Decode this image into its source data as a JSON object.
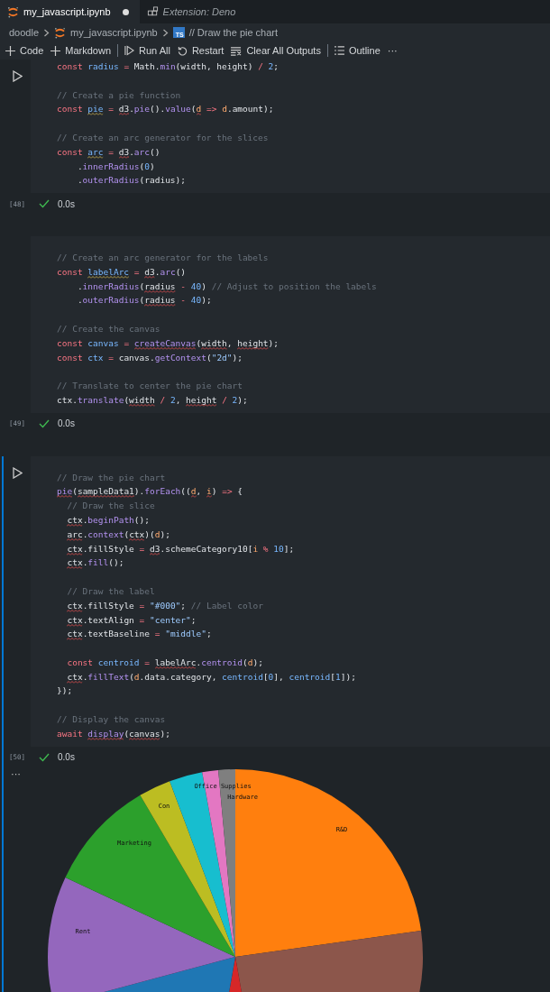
{
  "tabs": [
    {
      "label": "my_javascript.ipynb",
      "selected": true,
      "modified": true,
      "preview": false
    },
    {
      "label": "Extension: Deno",
      "selected": false,
      "modified": false,
      "preview": true
    }
  ],
  "breadcrumbs": [
    {
      "label": "doodle"
    },
    {
      "label": "my_javascript.ipynb"
    },
    {
      "label": "// Draw the pie chart",
      "badge": "TS"
    }
  ],
  "toolbar": [
    {
      "label": "Code",
      "divider_after": false
    },
    {
      "label": "Markdown",
      "divider_after": true
    },
    {
      "label": "Run All",
      "divider_after": false
    },
    {
      "label": "Restart",
      "divider_after": false
    },
    {
      "label": "Clear All Outputs",
      "divider_after": true
    },
    {
      "label": "Outline",
      "divider_after": false
    },
    {
      "label": "···",
      "divider_after": false
    }
  ],
  "cells": [
    {
      "focused": false,
      "run_button_visible": true,
      "count": "[48]",
      "succeeded": true,
      "time": "0.0s",
      "lines": [
        {
          "kind": "code",
          "tokens": [
            {
              "text": "const ",
              "kind": "kw"
            },
            {
              "text": "radius",
              "kind": "decl"
            },
            {
              "text": " = ",
              "kind": "kw"
            },
            {
              "text": "Math.",
              "kind": "plain"
            },
            {
              "text": "min",
              "kind": "fn"
            },
            {
              "text": "(width, height) ",
              "kind": "plain"
            },
            {
              "text": "/",
              "kind": "kw"
            },
            {
              "text": " 2",
              "kind": "num"
            },
            {
              "text": ";",
              "kind": "plain"
            }
          ]
        },
        {
          "kind": "blank"
        },
        {
          "kind": "code",
          "tokens": [
            {
              "text": "// Create a pie function",
              "kind": "cmt"
            }
          ]
        },
        {
          "kind": "code",
          "tokens": [
            {
              "text": "const ",
              "kind": "kw"
            },
            {
              "text": "pie",
              "kind": "decl",
              "warning": true
            },
            {
              "text": " = ",
              "kind": "kw"
            },
            {
              "text": "d3",
              "kind": "plain",
              "error": true
            },
            {
              "text": ".",
              "kind": "plain"
            },
            {
              "text": "pie",
              "kind": "fn"
            },
            {
              "text": "().",
              "kind": "plain"
            },
            {
              "text": "value",
              "kind": "fn"
            },
            {
              "text": "(",
              "kind": "plain"
            },
            {
              "text": "d",
              "kind": "param",
              "error": true
            },
            {
              "text": " => ",
              "kind": "kw"
            },
            {
              "text": "d",
              "kind": "param"
            },
            {
              "text": ".amount);",
              "kind": "plain"
            }
          ]
        },
        {
          "kind": "blank"
        },
        {
          "kind": "code",
          "tokens": [
            {
              "text": "// Create an arc generator for the slices",
              "kind": "cmt"
            }
          ]
        },
        {
          "kind": "code",
          "tokens": [
            {
              "text": "const ",
              "kind": "kw"
            },
            {
              "text": "arc",
              "kind": "decl",
              "warning": true
            },
            {
              "text": " = ",
              "kind": "kw"
            },
            {
              "text": "d3",
              "kind": "plain",
              "error": true
            },
            {
              "text": ".",
              "kind": "plain"
            },
            {
              "text": "arc",
              "kind": "fn"
            },
            {
              "text": "()",
              "kind": "plain"
            }
          ]
        },
        {
          "kind": "code",
          "tokens": [
            {
              "text": "    .",
              "kind": "plain"
            },
            {
              "text": "innerRadius",
              "kind": "fn"
            },
            {
              "text": "(",
              "kind": "plain"
            },
            {
              "text": "0",
              "kind": "num"
            },
            {
              "text": ")",
              "kind": "plain"
            }
          ]
        },
        {
          "kind": "code",
          "tokens": [
            {
              "text": "    .",
              "kind": "plain"
            },
            {
              "text": "outerRadius",
              "kind": "fn"
            },
            {
              "text": "(radius);",
              "kind": "plain"
            }
          ]
        }
      ]
    },
    {
      "focused": false,
      "run_button_visible": false,
      "count": "[49]",
      "succeeded": true,
      "time": "0.0s",
      "lines": [
        {
          "kind": "blank"
        },
        {
          "kind": "code",
          "tokens": [
            {
              "text": "// Create an arc generator for the labels",
              "kind": "cmt"
            }
          ]
        },
        {
          "kind": "code",
          "tokens": [
            {
              "text": "const ",
              "kind": "kw"
            },
            {
              "text": "labelArc",
              "kind": "decl",
              "warning": true
            },
            {
              "text": " = ",
              "kind": "kw"
            },
            {
              "text": "d3",
              "kind": "plain",
              "error": true
            },
            {
              "text": ".",
              "kind": "plain"
            },
            {
              "text": "arc",
              "kind": "fn"
            },
            {
              "text": "()",
              "kind": "plain"
            }
          ]
        },
        {
          "kind": "code",
          "tokens": [
            {
              "text": "    .",
              "kind": "plain"
            },
            {
              "text": "innerRadius",
              "kind": "fn"
            },
            {
              "text": "(",
              "kind": "plain"
            },
            {
              "text": "radius",
              "kind": "plain",
              "error": true
            },
            {
              "text": " - ",
              "kind": "kw"
            },
            {
              "text": "40",
              "kind": "num"
            },
            {
              "text": ") ",
              "kind": "plain"
            },
            {
              "text": "// Adjust to position the labels",
              "kind": "cmt"
            }
          ]
        },
        {
          "kind": "code",
          "tokens": [
            {
              "text": "    .",
              "kind": "plain"
            },
            {
              "text": "outerRadius",
              "kind": "fn"
            },
            {
              "text": "(",
              "kind": "plain"
            },
            {
              "text": "radius",
              "kind": "plain",
              "error": true
            },
            {
              "text": " - ",
              "kind": "kw"
            },
            {
              "text": "40",
              "kind": "num"
            },
            {
              "text": ");",
              "kind": "plain"
            }
          ]
        },
        {
          "kind": "blank"
        },
        {
          "kind": "code",
          "tokens": [
            {
              "text": "// Create the canvas",
              "kind": "cmt"
            }
          ]
        },
        {
          "kind": "code",
          "tokens": [
            {
              "text": "const ",
              "kind": "kw"
            },
            {
              "text": "canvas",
              "kind": "decl"
            },
            {
              "text": " = ",
              "kind": "kw"
            },
            {
              "text": "createCanvas",
              "kind": "fn",
              "error": true
            },
            {
              "text": "(",
              "kind": "plain"
            },
            {
              "text": "width",
              "kind": "plain",
              "error": true
            },
            {
              "text": ", ",
              "kind": "plain"
            },
            {
              "text": "height",
              "kind": "plain",
              "error": true
            },
            {
              "text": ");",
              "kind": "plain"
            }
          ]
        },
        {
          "kind": "code",
          "tokens": [
            {
              "text": "const ",
              "kind": "kw"
            },
            {
              "text": "ctx",
              "kind": "decl"
            },
            {
              "text": " = ",
              "kind": "kw"
            },
            {
              "text": "canvas.",
              "kind": "plain"
            },
            {
              "text": "getContext",
              "kind": "fn"
            },
            {
              "text": "(",
              "kind": "plain"
            },
            {
              "text": "\"2d\"",
              "kind": "str"
            },
            {
              "text": ");",
              "kind": "plain"
            }
          ]
        },
        {
          "kind": "blank"
        },
        {
          "kind": "code",
          "tokens": [
            {
              "text": "// Translate to center the pie chart",
              "kind": "cmt"
            }
          ]
        },
        {
          "kind": "code",
          "tokens": [
            {
              "text": "ctx.",
              "kind": "plain"
            },
            {
              "text": "translate",
              "kind": "fn"
            },
            {
              "text": "(",
              "kind": "plain"
            },
            {
              "text": "width",
              "kind": "plain",
              "error": true
            },
            {
              "text": " / ",
              "kind": "kw"
            },
            {
              "text": "2",
              "kind": "num"
            },
            {
              "text": ", ",
              "kind": "plain"
            },
            {
              "text": "height",
              "kind": "plain",
              "error": true
            },
            {
              "text": " / ",
              "kind": "kw"
            },
            {
              "text": "2",
              "kind": "num"
            },
            {
              "text": ");",
              "kind": "plain"
            }
          ]
        }
      ]
    },
    {
      "focused": true,
      "run_button_visible": true,
      "count": "[50]",
      "succeeded": true,
      "time": "0.0s",
      "lines": [
        {
          "kind": "blank"
        },
        {
          "kind": "code",
          "tokens": [
            {
              "text": "// Draw the pie chart",
              "kind": "cmt"
            }
          ]
        },
        {
          "kind": "code",
          "tokens": [
            {
              "text": "pie",
              "kind": "fn",
              "error": true
            },
            {
              "text": "(",
              "kind": "plain"
            },
            {
              "text": "sampleData1",
              "kind": "plain",
              "error": true
            },
            {
              "text": ").",
              "kind": "plain"
            },
            {
              "text": "forEach",
              "kind": "fn"
            },
            {
              "text": "((",
              "kind": "plain"
            },
            {
              "text": "d",
              "kind": "param",
              "error": true
            },
            {
              "text": ", ",
              "kind": "plain"
            },
            {
              "text": "i",
              "kind": "param",
              "error": true
            },
            {
              "text": ") ",
              "kind": "plain"
            },
            {
              "text": "=>",
              "kind": "kw"
            },
            {
              "text": " {",
              "kind": "plain"
            }
          ]
        },
        {
          "kind": "code",
          "tokens": [
            {
              "text": "  // Draw the slice",
              "kind": "cmt"
            }
          ]
        },
        {
          "kind": "code",
          "tokens": [
            {
              "text": "  ctx",
              "kind": "plain",
              "error": true
            },
            {
              "text": ".",
              "kind": "plain"
            },
            {
              "text": "beginPath",
              "kind": "fn"
            },
            {
              "text": "();",
              "kind": "plain"
            }
          ]
        },
        {
          "kind": "code",
          "tokens": [
            {
              "text": "  arc",
              "kind": "plain",
              "error": true
            },
            {
              "text": ".",
              "kind": "plain"
            },
            {
              "text": "context",
              "kind": "fn"
            },
            {
              "text": "(",
              "kind": "plain"
            },
            {
              "text": "ctx",
              "kind": "plain",
              "error": true
            },
            {
              "text": ")(",
              "kind": "plain"
            },
            {
              "text": "d",
              "kind": "param"
            },
            {
              "text": ");",
              "kind": "plain"
            }
          ]
        },
        {
          "kind": "code",
          "tokens": [
            {
              "text": "  ctx",
              "kind": "plain",
              "error": true
            },
            {
              "text": ".fillStyle ",
              "kind": "plain"
            },
            {
              "text": "= ",
              "kind": "kw"
            },
            {
              "text": "d3",
              "kind": "plain",
              "error": true
            },
            {
              "text": ".schemeCategory10[",
              "kind": "plain"
            },
            {
              "text": "i",
              "kind": "param"
            },
            {
              "text": " % ",
              "kind": "kw"
            },
            {
              "text": "10",
              "kind": "num"
            },
            {
              "text": "];",
              "kind": "plain"
            }
          ]
        },
        {
          "kind": "code",
          "tokens": [
            {
              "text": "  ctx",
              "kind": "plain",
              "error": true
            },
            {
              "text": ".",
              "kind": "plain"
            },
            {
              "text": "fill",
              "kind": "fn"
            },
            {
              "text": "();",
              "kind": "plain"
            }
          ]
        },
        {
          "kind": "blank"
        },
        {
          "kind": "code",
          "tokens": [
            {
              "text": "  // Draw the label",
              "kind": "cmt"
            }
          ]
        },
        {
          "kind": "code",
          "tokens": [
            {
              "text": "  ctx",
              "kind": "plain",
              "error": true
            },
            {
              "text": ".fillStyle ",
              "kind": "plain"
            },
            {
              "text": "= ",
              "kind": "kw"
            },
            {
              "text": "\"#000\"",
              "kind": "str"
            },
            {
              "text": "; ",
              "kind": "plain"
            },
            {
              "text": "// Label color",
              "kind": "cmt"
            }
          ]
        },
        {
          "kind": "code",
          "tokens": [
            {
              "text": "  ctx",
              "kind": "plain",
              "error": true
            },
            {
              "text": ".textAlign ",
              "kind": "plain"
            },
            {
              "text": "= ",
              "kind": "kw"
            },
            {
              "text": "\"center\"",
              "kind": "str"
            },
            {
              "text": ";",
              "kind": "plain"
            }
          ]
        },
        {
          "kind": "code",
          "tokens": [
            {
              "text": "  ctx",
              "kind": "plain",
              "error": true
            },
            {
              "text": ".textBaseline ",
              "kind": "plain"
            },
            {
              "text": "= ",
              "kind": "kw"
            },
            {
              "text": "\"middle\"",
              "kind": "str"
            },
            {
              "text": ";",
              "kind": "plain"
            }
          ]
        },
        {
          "kind": "blank"
        },
        {
          "kind": "code",
          "tokens": [
            {
              "text": "  const ",
              "kind": "kw"
            },
            {
              "text": "centroid",
              "kind": "decl"
            },
            {
              "text": " = ",
              "kind": "kw"
            },
            {
              "text": "labelArc",
              "kind": "plain",
              "error": true
            },
            {
              "text": ".",
              "kind": "plain"
            },
            {
              "text": "centroid",
              "kind": "fn"
            },
            {
              "text": "(",
              "kind": "plain"
            },
            {
              "text": "d",
              "kind": "param"
            },
            {
              "text": ");",
              "kind": "plain"
            }
          ]
        },
        {
          "kind": "code",
          "tokens": [
            {
              "text": "  ctx",
              "kind": "plain",
              "error": true
            },
            {
              "text": ".",
              "kind": "plain"
            },
            {
              "text": "fillText",
              "kind": "fn"
            },
            {
              "text": "(",
              "kind": "plain"
            },
            {
              "text": "d",
              "kind": "param"
            },
            {
              "text": ".data.category, ",
              "kind": "plain"
            },
            {
              "text": "centroid",
              "kind": "decl"
            },
            {
              "text": "[",
              "kind": "plain"
            },
            {
              "text": "0",
              "kind": "num"
            },
            {
              "text": "], ",
              "kind": "plain"
            },
            {
              "text": "centroid",
              "kind": "decl"
            },
            {
              "text": "[",
              "kind": "plain"
            },
            {
              "text": "1",
              "kind": "num"
            },
            {
              "text": "]);",
              "kind": "plain"
            }
          ]
        },
        {
          "kind": "code",
          "tokens": [
            {
              "text": "});",
              "kind": "plain"
            }
          ]
        },
        {
          "kind": "blank"
        },
        {
          "kind": "code",
          "tokens": [
            {
              "text": "// Display the canvas",
              "kind": "cmt"
            }
          ]
        },
        {
          "kind": "code",
          "tokens": [
            {
              "text": "await ",
              "kind": "kw"
            },
            {
              "text": "display",
              "kind": "fn",
              "error": true
            },
            {
              "text": "(",
              "kind": "plain"
            },
            {
              "text": "canvas",
              "kind": "plain",
              "error": true
            },
            {
              "text": ");",
              "kind": "plain"
            }
          ]
        }
      ],
      "output": {
        "menu": "···",
        "slices": [
          {
            "label": "R&D",
            "color": "#ff7f0e"
          },
          {
            "color": "#8c564b"
          },
          {
            "color": "#d62728"
          },
          {
            "color": "#1f77b4"
          },
          {
            "label": "Rent",
            "color": "#9467bd"
          },
          {
            "label": "Marketing",
            "color": "#2ca02c"
          },
          {
            "label": "Con",
            "color": "#bcbd22"
          },
          {
            "color": "#17becf"
          },
          {
            "label": "Office Supplies",
            "color": "#e377c2"
          },
          {
            "label": "Hardware",
            "color": "#7f7f7f"
          }
        ]
      }
    }
  ]
}
